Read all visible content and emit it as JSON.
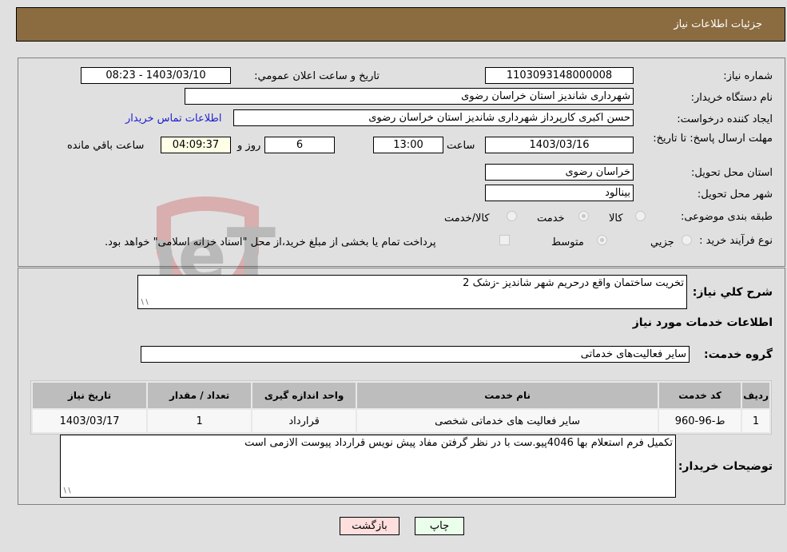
{
  "header": {
    "title": "جزئيات اطلاعات نياز"
  },
  "fields": {
    "need_number_label": "شماره نياز:",
    "need_number": "1103093148000008",
    "announce_label": "تاريخ و ساعت اعلان عمومي:",
    "announce_value": "1403/03/10 - 08:23",
    "buyer_org_label": "نام دستگاه خريدار:",
    "buyer_org": "شهرداری شانديز استان خراسان رضوی",
    "creator_label": "ايجاد کننده درخواست:",
    "creator": "حسن اکبری کارپرداز شهرداری شانديز استان خراسان رضوی",
    "contact_link": "اطلاعات تماس خريدار",
    "deadline_label": "مهلت ارسال پاسخ: تا تاريخ:",
    "deadline_date": "1403/03/16",
    "time_label": "ساعت",
    "deadline_time": "13:00",
    "days_value": "6",
    "days_label": "روز و",
    "remaining_time": "04:09:37",
    "remaining_label": "ساعت باقي مانده",
    "province_label": "استان محل تحويل:",
    "province": "خراسان رضوی",
    "city_label": "شهر محل تحويل:",
    "city": "بينالود",
    "category_label": "طبقه بندی موضوعی:",
    "category_options": [
      "کالا",
      "خدمت",
      "کالا/خدمت"
    ],
    "category_selected": "خدمت",
    "process_label": "نوع فرآيند خريد :",
    "process_options": [
      "جزيي",
      "متوسط"
    ],
    "process_selected": "متوسط",
    "treasury_note": "پرداخت تمام يا بخشی از مبلغ خريد،از محل \"اسناد خزانه اسلامی\" خواهد بود."
  },
  "description": {
    "label": "شرح کلي نياز:",
    "value": "تخريت ساختمان واقع درحريم شهر شانديز -زشک 2"
  },
  "services": {
    "section_title": "اطلاعات خدمات مورد نياز",
    "group_label": "گروه خدمت:",
    "group_value": "ساير فعاليت‌های خدماتی",
    "columns": [
      "رديف",
      "کد خدمت",
      "نام خدمت",
      "واحد اندازه گيری",
      "تعداد / مقدار",
      "تاريخ نياز"
    ],
    "rows": [
      [
        "1",
        "ط-96-960",
        "ساير فعاليت های خدماتی شخصی",
        "قرارداد",
        "1",
        "1403/03/17"
      ]
    ]
  },
  "buyer_notes": {
    "label": "توضيحات خريدار:",
    "value": "تکميل فرم استعلام بها 4046پيو.ست با در نظر گرفتن مفاد پيش نويس قرارداد پيوست الازمی است"
  },
  "buttons": {
    "print": "چاپ",
    "back": "بازگشت"
  },
  "watermark": "AriaTender.neT"
}
